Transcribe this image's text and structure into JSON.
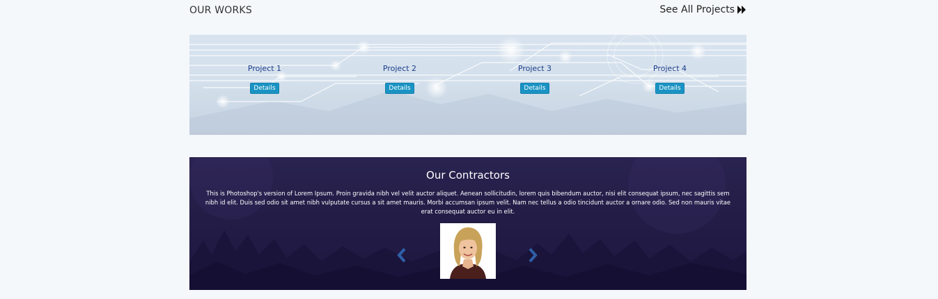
{
  "works": {
    "title": "OUR WORKS",
    "see_all_label": "See All Projects",
    "see_all_icon": "double-chevron-right-icon",
    "projects": [
      {
        "name": "Project 1",
        "button": "Details"
      },
      {
        "name": "Project 2",
        "button": "Details"
      },
      {
        "name": "Project 3",
        "button": "Details"
      },
      {
        "name": "Project 4",
        "button": "Details"
      }
    ]
  },
  "contractors": {
    "title": "Our Contractors",
    "text": "This is Photoshop's version of Lorem Ipsum. Proin gravida nibh vel velit auctor aliquet. Aenean sollicitudin, lorem quis bibendum auctor, nisi elit consequat ipsum, nec sagittis sem nibh id elit. Duis sed odio sit amet nibh vulputate cursus a sit amet mauris. Morbi accumsan ipsum velit. Nam nec tellus a odio tincidunt auctor a ornare odio. Sed non mauris vitae erat consequat auctor eu in elit.",
    "prev_icon": "chevron-left-icon",
    "next_icon": "chevron-right-icon"
  },
  "colors": {
    "page_bg": "#f5f8fb",
    "project_link": "#1c3d8a",
    "details_button": "#1a93c4",
    "contractors_bg": "#231d47",
    "arrow": "#2f5fa8"
  }
}
